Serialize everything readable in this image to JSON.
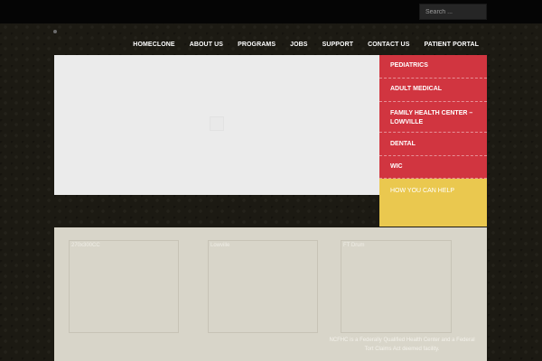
{
  "search": {
    "placeholder": "Search ..."
  },
  "nav": {
    "items": [
      {
        "label": "HOMECLONE"
      },
      {
        "label": "ABOUT US"
      },
      {
        "label": "PROGRAMS"
      },
      {
        "label": "JOBS"
      },
      {
        "label": "SUPPORT"
      },
      {
        "label": "CONTACT US"
      },
      {
        "label": "PATIENT PORTAL"
      }
    ]
  },
  "side_menu": {
    "items": [
      {
        "label": "PEDIATRICS"
      },
      {
        "label": "ADULT MEDICAL"
      },
      {
        "label": "FAMILY HEALTH CENTER – LOWVILLE"
      },
      {
        "label": "DENTAL"
      },
      {
        "label": "WIC"
      }
    ],
    "help_label": "HOW YOU CAN HELP"
  },
  "cards": [
    {
      "label": "270x300CC"
    },
    {
      "label": "Lowville"
    },
    {
      "label": "FT Drum"
    }
  ],
  "footer_note": "NCFHC is a Federally Qualified Health Center and a Federal Tort Claims Act deemed facility.",
  "colors": {
    "side_menu_red": "#d13540",
    "help_yellow": "#eac84f",
    "content_bg": "#d8d5c9"
  }
}
